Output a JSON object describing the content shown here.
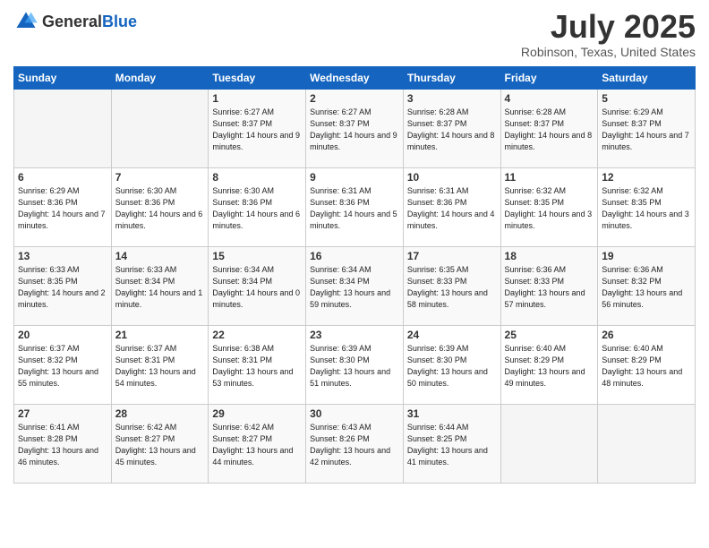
{
  "header": {
    "logo_general": "General",
    "logo_blue": "Blue",
    "month_title": "July 2025",
    "location": "Robinson, Texas, United States"
  },
  "weekdays": [
    "Sunday",
    "Monday",
    "Tuesday",
    "Wednesday",
    "Thursday",
    "Friday",
    "Saturday"
  ],
  "weeks": [
    [
      {
        "day": "",
        "info": ""
      },
      {
        "day": "",
        "info": ""
      },
      {
        "day": "1",
        "info": "Sunrise: 6:27 AM\nSunset: 8:37 PM\nDaylight: 14 hours and 9 minutes."
      },
      {
        "day": "2",
        "info": "Sunrise: 6:27 AM\nSunset: 8:37 PM\nDaylight: 14 hours and 9 minutes."
      },
      {
        "day": "3",
        "info": "Sunrise: 6:28 AM\nSunset: 8:37 PM\nDaylight: 14 hours and 8 minutes."
      },
      {
        "day": "4",
        "info": "Sunrise: 6:28 AM\nSunset: 8:37 PM\nDaylight: 14 hours and 8 minutes."
      },
      {
        "day": "5",
        "info": "Sunrise: 6:29 AM\nSunset: 8:37 PM\nDaylight: 14 hours and 7 minutes."
      }
    ],
    [
      {
        "day": "6",
        "info": "Sunrise: 6:29 AM\nSunset: 8:36 PM\nDaylight: 14 hours and 7 minutes."
      },
      {
        "day": "7",
        "info": "Sunrise: 6:30 AM\nSunset: 8:36 PM\nDaylight: 14 hours and 6 minutes."
      },
      {
        "day": "8",
        "info": "Sunrise: 6:30 AM\nSunset: 8:36 PM\nDaylight: 14 hours and 6 minutes."
      },
      {
        "day": "9",
        "info": "Sunrise: 6:31 AM\nSunset: 8:36 PM\nDaylight: 14 hours and 5 minutes."
      },
      {
        "day": "10",
        "info": "Sunrise: 6:31 AM\nSunset: 8:36 PM\nDaylight: 14 hours and 4 minutes."
      },
      {
        "day": "11",
        "info": "Sunrise: 6:32 AM\nSunset: 8:35 PM\nDaylight: 14 hours and 3 minutes."
      },
      {
        "day": "12",
        "info": "Sunrise: 6:32 AM\nSunset: 8:35 PM\nDaylight: 14 hours and 3 minutes."
      }
    ],
    [
      {
        "day": "13",
        "info": "Sunrise: 6:33 AM\nSunset: 8:35 PM\nDaylight: 14 hours and 2 minutes."
      },
      {
        "day": "14",
        "info": "Sunrise: 6:33 AM\nSunset: 8:34 PM\nDaylight: 14 hours and 1 minute."
      },
      {
        "day": "15",
        "info": "Sunrise: 6:34 AM\nSunset: 8:34 PM\nDaylight: 14 hours and 0 minutes."
      },
      {
        "day": "16",
        "info": "Sunrise: 6:34 AM\nSunset: 8:34 PM\nDaylight: 13 hours and 59 minutes."
      },
      {
        "day": "17",
        "info": "Sunrise: 6:35 AM\nSunset: 8:33 PM\nDaylight: 13 hours and 58 minutes."
      },
      {
        "day": "18",
        "info": "Sunrise: 6:36 AM\nSunset: 8:33 PM\nDaylight: 13 hours and 57 minutes."
      },
      {
        "day": "19",
        "info": "Sunrise: 6:36 AM\nSunset: 8:32 PM\nDaylight: 13 hours and 56 minutes."
      }
    ],
    [
      {
        "day": "20",
        "info": "Sunrise: 6:37 AM\nSunset: 8:32 PM\nDaylight: 13 hours and 55 minutes."
      },
      {
        "day": "21",
        "info": "Sunrise: 6:37 AM\nSunset: 8:31 PM\nDaylight: 13 hours and 54 minutes."
      },
      {
        "day": "22",
        "info": "Sunrise: 6:38 AM\nSunset: 8:31 PM\nDaylight: 13 hours and 53 minutes."
      },
      {
        "day": "23",
        "info": "Sunrise: 6:39 AM\nSunset: 8:30 PM\nDaylight: 13 hours and 51 minutes."
      },
      {
        "day": "24",
        "info": "Sunrise: 6:39 AM\nSunset: 8:30 PM\nDaylight: 13 hours and 50 minutes."
      },
      {
        "day": "25",
        "info": "Sunrise: 6:40 AM\nSunset: 8:29 PM\nDaylight: 13 hours and 49 minutes."
      },
      {
        "day": "26",
        "info": "Sunrise: 6:40 AM\nSunset: 8:29 PM\nDaylight: 13 hours and 48 minutes."
      }
    ],
    [
      {
        "day": "27",
        "info": "Sunrise: 6:41 AM\nSunset: 8:28 PM\nDaylight: 13 hours and 46 minutes."
      },
      {
        "day": "28",
        "info": "Sunrise: 6:42 AM\nSunset: 8:27 PM\nDaylight: 13 hours and 45 minutes."
      },
      {
        "day": "29",
        "info": "Sunrise: 6:42 AM\nSunset: 8:27 PM\nDaylight: 13 hours and 44 minutes."
      },
      {
        "day": "30",
        "info": "Sunrise: 6:43 AM\nSunset: 8:26 PM\nDaylight: 13 hours and 42 minutes."
      },
      {
        "day": "31",
        "info": "Sunrise: 6:44 AM\nSunset: 8:25 PM\nDaylight: 13 hours and 41 minutes."
      },
      {
        "day": "",
        "info": ""
      },
      {
        "day": "",
        "info": ""
      }
    ]
  ]
}
